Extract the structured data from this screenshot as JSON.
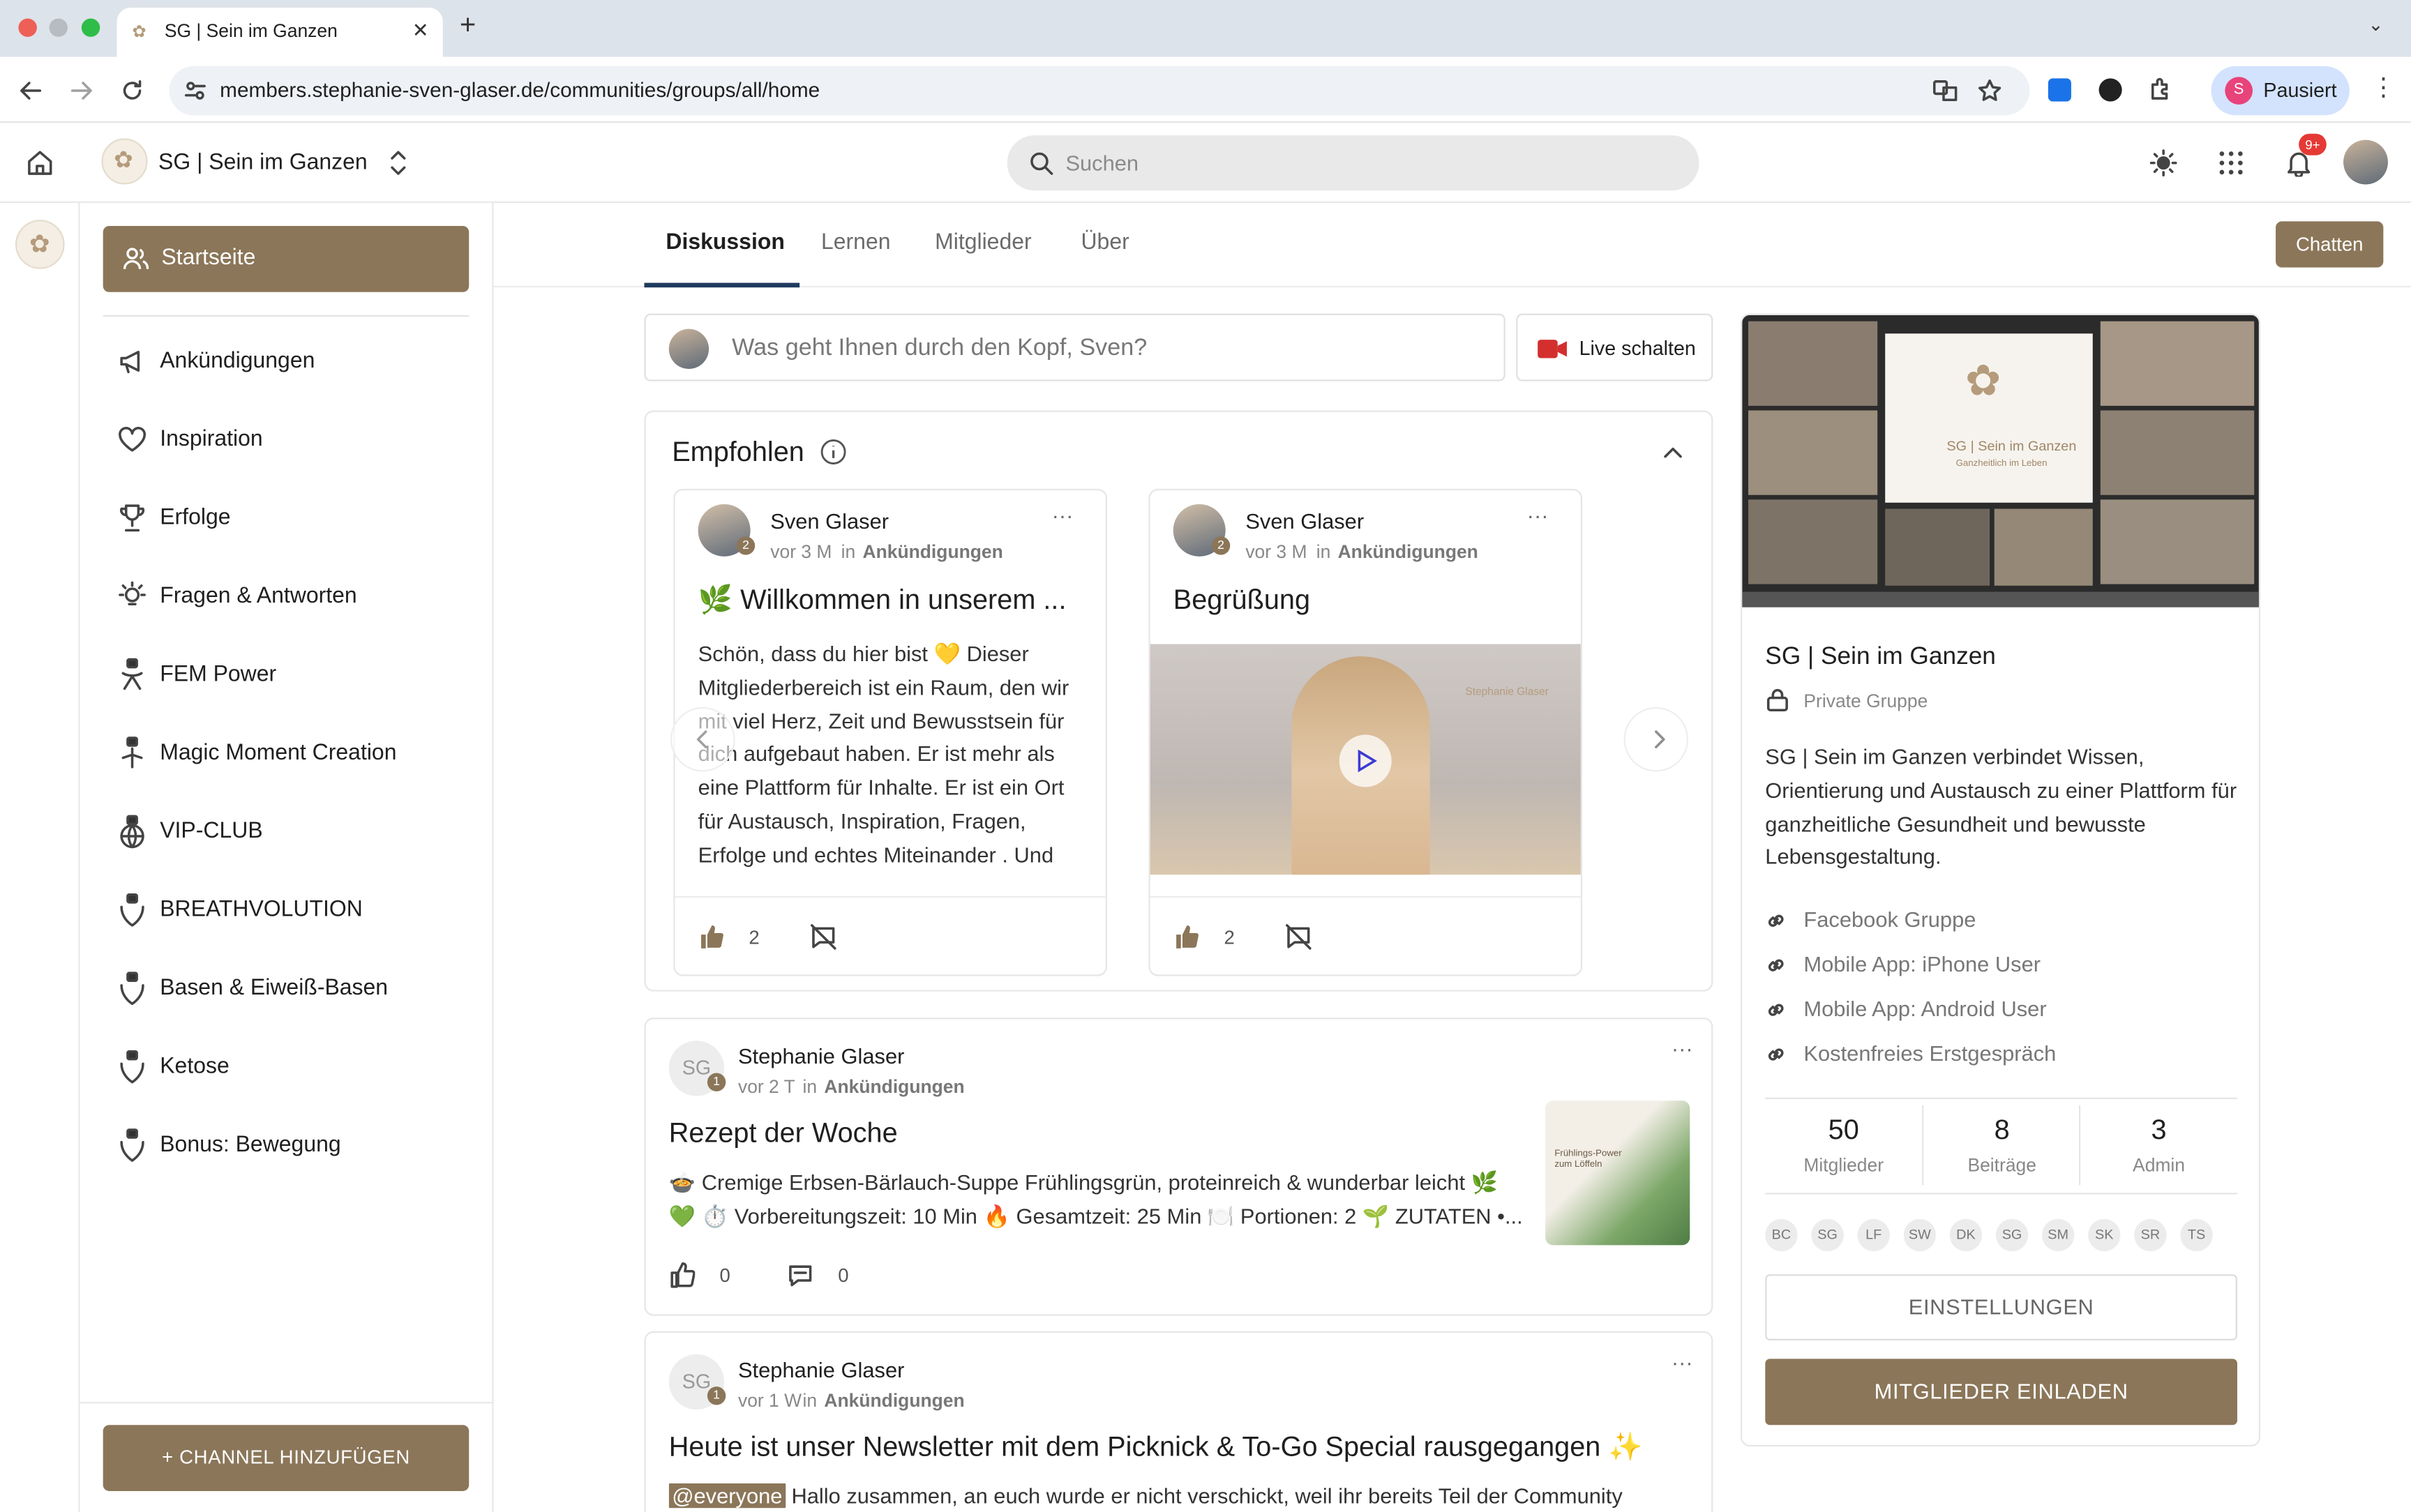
{
  "browser": {
    "tab_title": "SG | Sein im Ganzen",
    "url": "members.stephanie-sven-glaser.de/communities/groups/all/home",
    "profile_label": "Pausiert",
    "profile_initial": "S"
  },
  "header": {
    "community_name": "SG | Sein im Ganzen",
    "search_placeholder": "Suchen",
    "notification_badge": "9+"
  },
  "sidebar": {
    "home_label": "Startseite",
    "items": [
      {
        "label": "Ankündigungen",
        "icon": "megaphone-icon"
      },
      {
        "label": "Inspiration",
        "icon": "heart-icon"
      },
      {
        "label": "Erfolge",
        "icon": "trophy-icon"
      },
      {
        "label": "Fragen & Antworten",
        "icon": "lightbulb-icon"
      },
      {
        "label": "FEM Power",
        "icon": "lock-icon"
      },
      {
        "label": "Magic Moment Creation",
        "icon": "lock-icon"
      },
      {
        "label": "VIP-CLUB",
        "icon": "lock-icon"
      },
      {
        "label": "BREATHVOLUTION",
        "icon": "lock-icon"
      },
      {
        "label": "Basen & Eiweiß-Basen",
        "icon": "lock-icon"
      },
      {
        "label": "Ketose",
        "icon": "lock-icon"
      },
      {
        "label": "Bonus: Bewegung",
        "icon": "lock-icon"
      }
    ],
    "add_channel_label": "+ CHANNEL HINZUFÜGEN"
  },
  "tabs": [
    {
      "label": "Diskussion",
      "active": true
    },
    {
      "label": "Lernen",
      "active": false
    },
    {
      "label": "Mitglieder",
      "active": false
    },
    {
      "label": "Über",
      "active": false
    }
  ],
  "chat_button": "Chatten",
  "composer": {
    "placeholder": "Was geht Ihnen durch den Kopf, Sven?",
    "live_label": "Live schalten"
  },
  "featured": {
    "title": "Empfohlen",
    "cards": [
      {
        "author": "Sven Glaser",
        "level": "2",
        "time": "vor 3 M",
        "in": "in",
        "channel": "Ankündigungen",
        "title": "🌿 Willkommen in unserem ...",
        "body": "Schön, dass du hier bist 💛 Dieser Mitgliederbereich ist ein Raum, den wir mit viel Herz, Zeit und Bewusstsein für dich aufgebaut haben. Er ist mehr als eine Plattform für Inhalte. Er ist ein Ort für Austausch, Inspiration, Fragen, Erfolge und echtes Miteinander . Und",
        "likes": "2"
      },
      {
        "author": "Sven Glaser",
        "level": "2",
        "time": "vor 3 M",
        "in": "in",
        "channel": "Ankündigungen",
        "title": "Begrüßung",
        "likes": "2",
        "video_watermark": "Stephanie Glaser"
      }
    ]
  },
  "posts": [
    {
      "initials": "SG",
      "author": "Stephanie Glaser",
      "level": "1",
      "time": "vor 2 T",
      "in": "in",
      "channel": "Ankündigungen",
      "title": "Rezept der Woche",
      "line1": "🍲 Cremige Erbsen-Bärlauch-Suppe Frühlingsgrün, proteinreich & wunderbar leicht 🌿",
      "line2": "💚 ⏱️ Vorbereitungszeit: 10 Min 🔥 Gesamtzeit: 25 Min 🍽️ Portionen: 2 🌱 ZUTATEN •...",
      "likes": "0",
      "comments": "0",
      "thumb_text": "Frühlings-Power zum Löffeln"
    },
    {
      "initials": "SG",
      "author": "Stephanie Glaser",
      "level": "1",
      "time": "vor 1 W",
      "in": "in",
      "channel": "Ankündigungen",
      "title": "Heute ist unser Newsletter mit dem Picknick & To-Go Special rausgegangen ✨",
      "mention": "@everyone",
      "body": " Hallo zusammen, an euch wurde er nicht verschickt, weil ihr bereits Teil der Community"
    }
  ],
  "group": {
    "name": "SG | Sein im Ganzen",
    "privacy": "Private Gruppe",
    "description": "SG | Sein im Ganzen verbindet Wissen, Orientierung und Austausch zu einer Plattform für ganzheitliche Gesundheit und bewusste Lebensgestaltung.",
    "links": [
      "Facebook Gruppe",
      "Mobile App: iPhone User",
      "Mobile App: Android User",
      "Kostenfreies Erstgespräch"
    ],
    "stats": [
      {
        "value": "50",
        "label": "Mitglieder"
      },
      {
        "value": "8",
        "label": "Beiträge"
      },
      {
        "value": "3",
        "label": "Admin"
      }
    ],
    "member_initials": [
      "BC",
      "SG",
      "LF",
      "SW",
      "DK",
      "SG",
      "SM",
      "SK",
      "SR",
      "TS"
    ],
    "settings_label": "EINSTELLUNGEN",
    "invite_label": "MITGLIEDER EINLADEN",
    "cover_text": "SG | Sein im Ganzen",
    "cover_subtext": "Ganzheitlich im Leben"
  },
  "colors": {
    "accent": "#8b7659",
    "tab_active": "#1f3a5f",
    "chrome": "#dde3ea"
  }
}
